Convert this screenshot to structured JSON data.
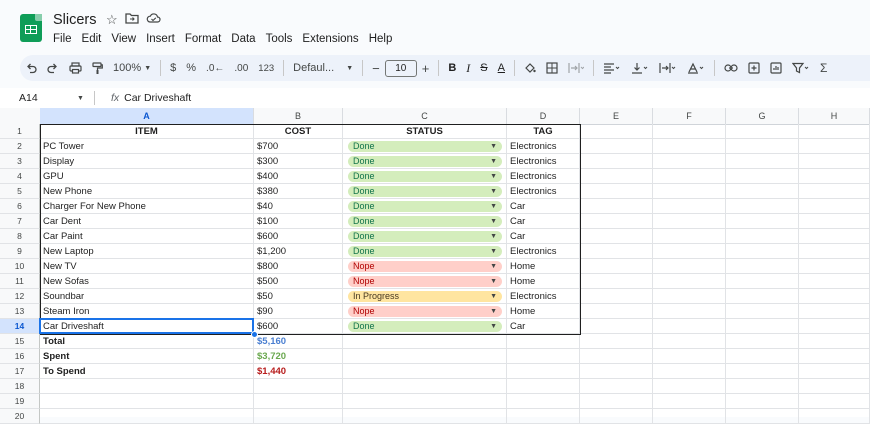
{
  "doc": {
    "title": "Slicers"
  },
  "menu": [
    "File",
    "Edit",
    "View",
    "Insert",
    "Format",
    "Data",
    "Tools",
    "Extensions",
    "Help"
  ],
  "toolbar": {
    "zoom": "100%",
    "currency": "$",
    "percent": "%",
    "dec_decrease": ".0←",
    "dec_increase": ".00",
    "format_123": "123",
    "font": "Defaul...",
    "font_size": "10",
    "bold": "B",
    "italic": "I",
    "strike": "S",
    "text_color": "A",
    "sum": "Σ"
  },
  "formula_bar": {
    "cell_ref": "A14",
    "fx": "fx",
    "value": "Car Driveshaft"
  },
  "columns": [
    "A",
    "B",
    "C",
    "D",
    "E",
    "F",
    "G",
    "H"
  ],
  "headers": {
    "item": "ITEM",
    "cost": "COST",
    "status": "STATUS",
    "tag": "TAG"
  },
  "rows": [
    {
      "item": "PC Tower",
      "cost": "$700",
      "status": "Done",
      "tag": "Electronics"
    },
    {
      "item": "Display",
      "cost": "$300",
      "status": "Done",
      "tag": "Electronics"
    },
    {
      "item": "GPU",
      "cost": "$400",
      "status": "Done",
      "tag": "Electronics"
    },
    {
      "item": "New Phone",
      "cost": "$380",
      "status": "Done",
      "tag": "Electronics"
    },
    {
      "item": "Charger For New Phone",
      "cost": "$40",
      "status": "Done",
      "tag": "Car"
    },
    {
      "item": "Car Dent",
      "cost": "$100",
      "status": "Done",
      "tag": "Car"
    },
    {
      "item": "Car Paint",
      "cost": "$600",
      "status": "Done",
      "tag": "Car"
    },
    {
      "item": "New Laptop",
      "cost": "$1,200",
      "status": "Done",
      "tag": "Electronics"
    },
    {
      "item": "New TV",
      "cost": "$800",
      "status": "Nope",
      "tag": "Home"
    },
    {
      "item": "New Sofas",
      "cost": "$500",
      "status": "Nope",
      "tag": "Home"
    },
    {
      "item": "Soundbar",
      "cost": "$50",
      "status": "In Progress",
      "tag": "Electronics"
    },
    {
      "item": "Steam Iron",
      "cost": "$90",
      "status": "Nope",
      "tag": "Home"
    },
    {
      "item": "Car Driveshaft",
      "cost": "$600",
      "status": "Done",
      "tag": "Car"
    }
  ],
  "summary": [
    {
      "label": "Total",
      "value": "$5,160",
      "color": "#4a7fd1"
    },
    {
      "label": "Spent",
      "value": "$3,720",
      "color": "#6aa84f"
    },
    {
      "label": "To Spend",
      "value": "$1,440",
      "color": "#b71c1c"
    }
  ],
  "status_colors": {
    "Done": {
      "bg": "#d4edbc",
      "fg": "#11734b"
    },
    "Nope": {
      "bg": "#ffcfc9",
      "fg": "#b10202"
    },
    "In Progress": {
      "bg": "#ffe5a0",
      "fg": "#473821"
    }
  },
  "selected": {
    "row": 14,
    "col": "A"
  },
  "row_numbers": [
    "1",
    "2",
    "3",
    "4",
    "5",
    "6",
    "7",
    "8",
    "9",
    "10",
    "11",
    "12",
    "13",
    "14",
    "15",
    "16",
    "17",
    "18",
    "19",
    "20"
  ]
}
